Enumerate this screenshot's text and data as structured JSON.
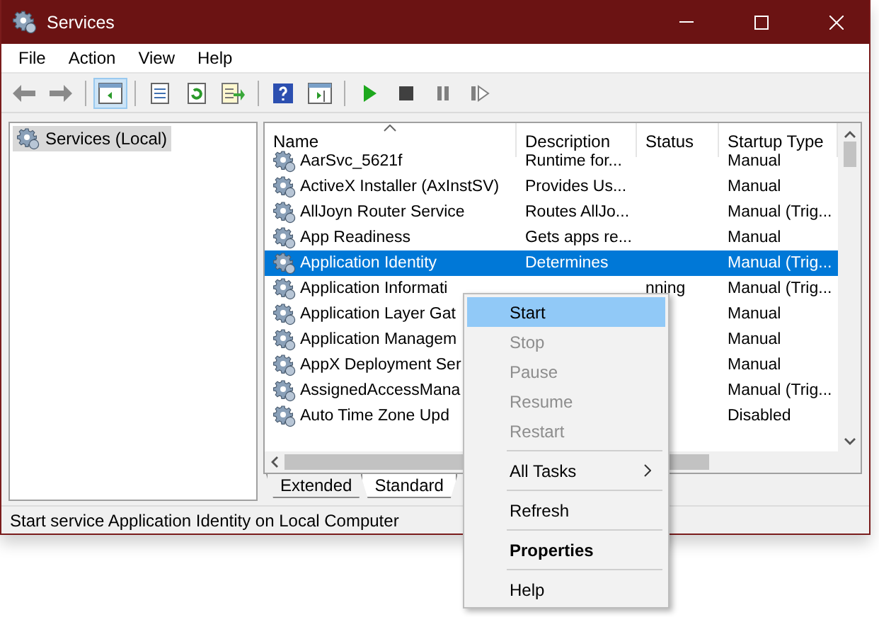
{
  "window": {
    "title": "Services"
  },
  "menu_bar": [
    "File",
    "Action",
    "View",
    "Help"
  ],
  "toolbar": {
    "buttons": [
      {
        "kind": "back",
        "selected": false
      },
      {
        "kind": "forward",
        "selected": false
      },
      {
        "kind": "tree",
        "selected": true
      },
      {
        "kind": "sheet",
        "selected": false
      },
      {
        "kind": "refresh",
        "selected": false
      },
      {
        "kind": "export",
        "selected": false
      },
      {
        "kind": "help",
        "selected": false
      },
      {
        "kind": "pane",
        "selected": false
      },
      {
        "kind": "play",
        "selected": false
      },
      {
        "kind": "stop",
        "selected": false
      },
      {
        "kind": "pause",
        "selected": false
      },
      {
        "kind": "resume",
        "selected": false
      }
    ]
  },
  "tree": {
    "items": [
      {
        "label": "Services (Local)",
        "selected": true
      }
    ]
  },
  "table": {
    "columns": [
      {
        "label": "Name",
        "sorted": true
      },
      {
        "label": "Description",
        "sorted": false
      },
      {
        "label": "Status",
        "sorted": false
      },
      {
        "label": "Startup Type",
        "sorted": false
      }
    ],
    "rows": [
      {
        "name": "AarSvc_5621f",
        "description": "Runtime for...",
        "status": "",
        "startup_type": "Manual",
        "selected": false
      },
      {
        "name": "ActiveX Installer (AxInstSV)",
        "description": "Provides Us...",
        "status": "",
        "startup_type": "Manual",
        "selected": false
      },
      {
        "name": "AllJoyn Router Service",
        "description": "Routes AllJo...",
        "status": "",
        "startup_type": "Manual (Trig...",
        "selected": false
      },
      {
        "name": "App Readiness",
        "description": "Gets apps re...",
        "status": "",
        "startup_type": "Manual",
        "selected": false
      },
      {
        "name": "Application Identity",
        "description": "Determines",
        "status": "",
        "startup_type": "Manual (Trig...",
        "selected": true
      },
      {
        "name": "Application Informati",
        "description": "",
        "status": "nning",
        "startup_type": "Manual (Trig...",
        "selected": false
      },
      {
        "name": "Application Layer Gat",
        "description": "",
        "status": "",
        "startup_type": "Manual",
        "selected": false
      },
      {
        "name": "Application Managem",
        "description": "",
        "status": "",
        "startup_type": "Manual",
        "selected": false
      },
      {
        "name": "AppX Deployment Ser",
        "description": "",
        "status": "",
        "startup_type": "Manual",
        "selected": false
      },
      {
        "name": "AssignedAccessMana",
        "description": "",
        "status": "",
        "startup_type": "Manual (Trig...",
        "selected": false
      },
      {
        "name": "Auto Time Zone Upd",
        "description": "",
        "status": "",
        "startup_type": "Disabled",
        "selected": false
      }
    ]
  },
  "view_tabs": [
    {
      "label": "Extended",
      "selected": false
    },
    {
      "label": "Standard",
      "selected": true
    }
  ],
  "status_bar": "Start service Application Identity on Local Computer",
  "context_menu": [
    {
      "kind": "item",
      "label": "Start",
      "disabled": false,
      "selected": true
    },
    {
      "kind": "item",
      "label": "Stop",
      "disabled": true,
      "selected": false
    },
    {
      "kind": "item",
      "label": "Pause",
      "disabled": true,
      "selected": false
    },
    {
      "kind": "item",
      "label": "Resume",
      "disabled": true,
      "selected": false
    },
    {
      "kind": "item",
      "label": "Restart",
      "disabled": true,
      "selected": false
    },
    {
      "kind": "separator"
    },
    {
      "kind": "submenu",
      "label": "All Tasks",
      "disabled": false,
      "selected": false
    },
    {
      "kind": "separator"
    },
    {
      "kind": "item",
      "label": "Refresh",
      "disabled": false,
      "selected": false
    },
    {
      "kind": "separator"
    },
    {
      "kind": "default",
      "label": "Properties",
      "disabled": false,
      "selected": false
    },
    {
      "kind": "separator"
    },
    {
      "kind": "item",
      "label": "Help",
      "disabled": false,
      "selected": false
    }
  ]
}
